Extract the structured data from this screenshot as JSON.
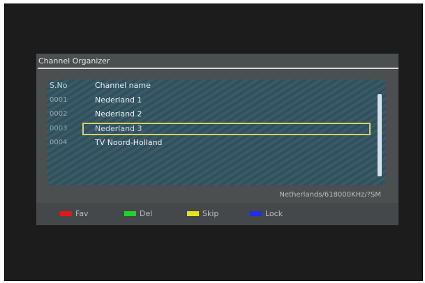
{
  "panel": {
    "title": "Channel Organizer"
  },
  "list": {
    "header_sno": "S.No",
    "header_name": "Channel name",
    "rows": [
      {
        "sno": "0001",
        "name": "Nederland 1"
      },
      {
        "sno": "0002",
        "name": "Nederland 2"
      },
      {
        "sno": "0003",
        "name": "Nederland 3"
      },
      {
        "sno": "0004",
        "name": "TV Noord-Holland"
      }
    ],
    "selected_index": 2
  },
  "status": {
    "transponder": "Netherlands/618000KHz/?SM"
  },
  "footer": {
    "keys": [
      {
        "label": "Fav",
        "color": "#e01818"
      },
      {
        "label": "Del",
        "color": "#1ed32a"
      },
      {
        "label": "Skip",
        "color": "#e6e21a"
      },
      {
        "label": "Lock",
        "color": "#2030e0"
      }
    ]
  },
  "colors": {
    "panel_bg": "#4b4f50",
    "list_bg": "#3a5a68",
    "highlight_border": "#d9d35a"
  }
}
